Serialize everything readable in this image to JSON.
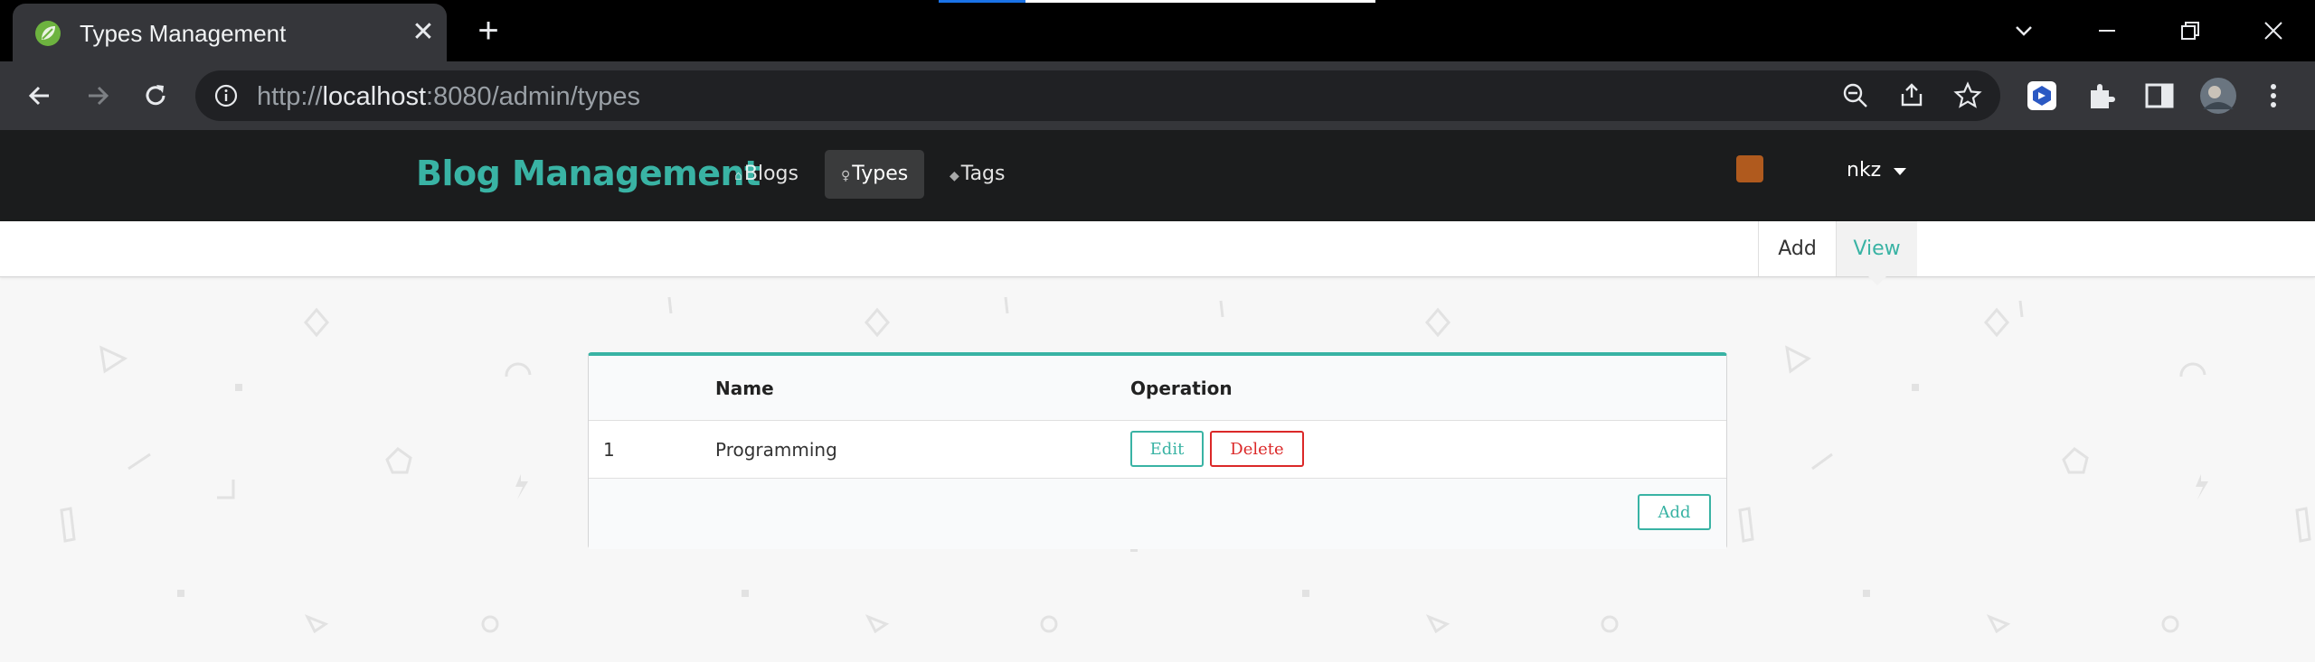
{
  "browser": {
    "tab_title": "Types Management",
    "url_prefix": "http://",
    "url_host": "localhost",
    "url_rest": ":8080/admin/types",
    "colors": {
      "chrome_dark": "#35363a",
      "omnibox": "#202124"
    }
  },
  "nav": {
    "brand": "Blog Management",
    "items": [
      {
        "label": "Blogs",
        "icon": "home-icon"
      },
      {
        "label": "Types",
        "icon": "idea-icon"
      },
      {
        "label": "Tags",
        "icon": "tags-icon"
      }
    ],
    "user": {
      "name": "nkz"
    },
    "colors": {
      "brand": "#39b3a4",
      "background": "#1b1c1d"
    }
  },
  "submenu": {
    "add_label": "Add",
    "view_label": "View"
  },
  "table": {
    "headers": [
      "",
      "Name",
      "Operation"
    ],
    "rows": [
      {
        "id": "1",
        "name": "Programming",
        "edit_label": "Edit",
        "delete_label": "Delete"
      }
    ],
    "footer_add_label": "Add",
    "colors": {
      "accent": "#39b3a4",
      "danger": "#db2828"
    }
  }
}
